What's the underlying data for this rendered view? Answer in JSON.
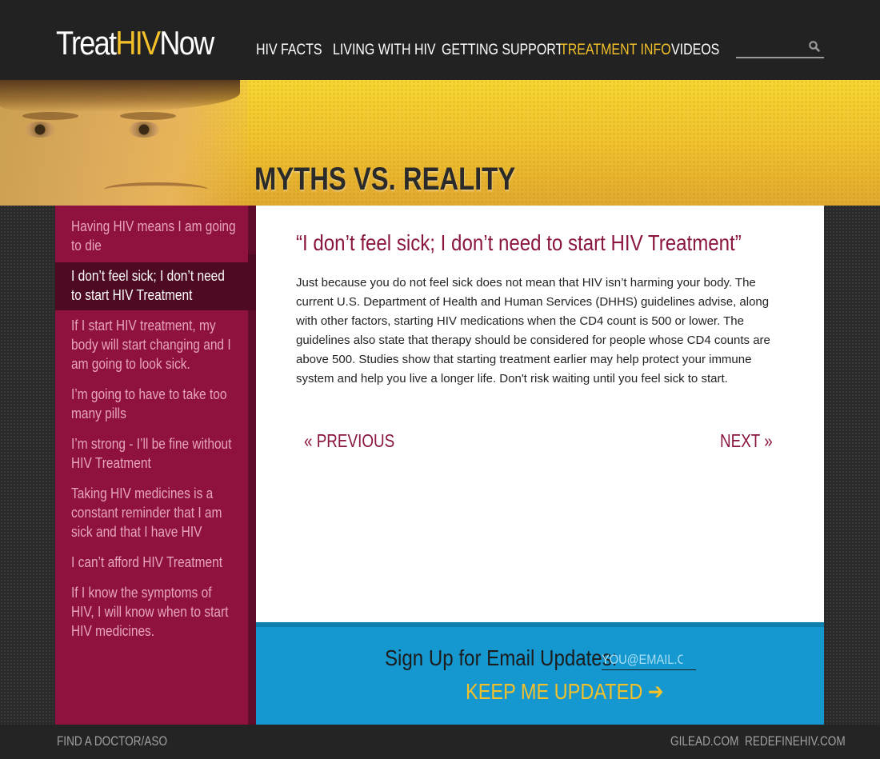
{
  "header": {
    "logo": {
      "part1": "Treat",
      "part2": "HIV",
      "part3": "Now"
    },
    "nav": [
      {
        "label": "HIV FACTS"
      },
      {
        "label": "LIVING WITH HIV"
      },
      {
        "label": "GETTING SUPPORT"
      },
      {
        "label": "TREATMENT INFO",
        "active": true
      },
      {
        "label": "VIDEOS"
      }
    ],
    "search": {
      "placeholder": "",
      "icon": "search-icon"
    }
  },
  "hero": {
    "title": "MYTHS VS. REALITY"
  },
  "sidebar": {
    "items": [
      {
        "label": "Having HIV means I am going to die"
      },
      {
        "label": "I don’t feel sick; I don’t need to start HIV Treatment",
        "active": true
      },
      {
        "label": "If I start HIV treatment, my body will start changing and I am going to look sick."
      },
      {
        "label": "I’m going to have to take too many pills"
      },
      {
        "label": "I’m strong - I’ll be fine without HIV Treatment"
      },
      {
        "label": "Taking HIV medicines is a constant reminder that I am sick and that I have HIV"
      },
      {
        "label": "I can’t afford HIV Treatment"
      },
      {
        "label": "If I know the symptoms of HIV, I will know when to start HIV medicines."
      }
    ]
  },
  "main": {
    "title": "“I don’t feel sick; I don’t need to start HIV Treatment”",
    "body": "Just because you do not feel sick does not mean that HIV isn’t harming your body. The current U.S. Department of Health and Human Services (DHHS) guidelines advise, along with other factors, starting HIV medications when the CD4 count is 500 or lower. The guidelines also state that therapy should be considered for people whose CD4 counts are above 500. Studies show that starting treatment earlier may help protect your immune system and help you live a longer life. Don't risk waiting until you feel sick to start.",
    "prev_label": "« PREVIOUS",
    "next_label": "NEXT »"
  },
  "signup": {
    "label": "Sign Up for Email Updates:",
    "email_placeholder": "YOU@EMAIL.COM",
    "button_label": "KEEP ME UPDATED ➔"
  },
  "footer": {
    "left_link": "FIND A DOCTOR/ASO",
    "right_links": [
      "GILEAD.COM",
      "REDEFINEHIV.COM"
    ]
  },
  "colors": {
    "accent_yellow": "#f4c12a",
    "sidebar_magenta": "#8f1140",
    "sidebar_active": "#4d0a22",
    "title_maroon": "#8a1540",
    "signup_blue": "#1597cf"
  }
}
